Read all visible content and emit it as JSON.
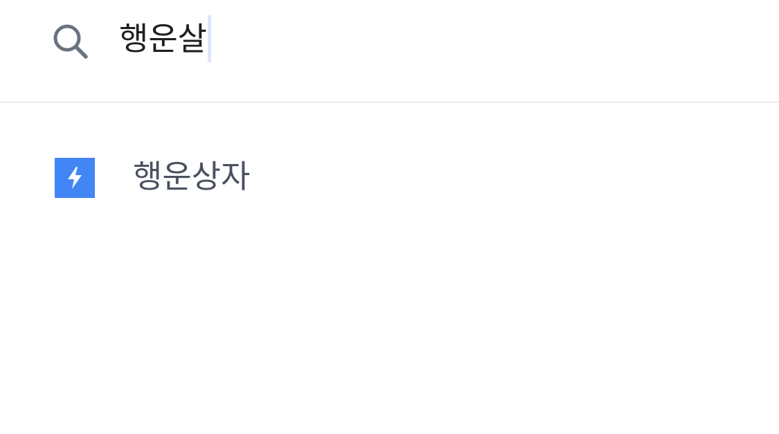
{
  "search": {
    "query": "행운살",
    "icon": "search-icon"
  },
  "suggestions": [
    {
      "label": "행운상자",
      "icon": "lightning-bolt-icon",
      "icon_color": "#4285f4"
    }
  ],
  "colors": {
    "divider": "#dcdcdc",
    "icon_gray": "#6b7280",
    "suggestion_text": "#4a5260",
    "caret": "#dfe5fb"
  }
}
